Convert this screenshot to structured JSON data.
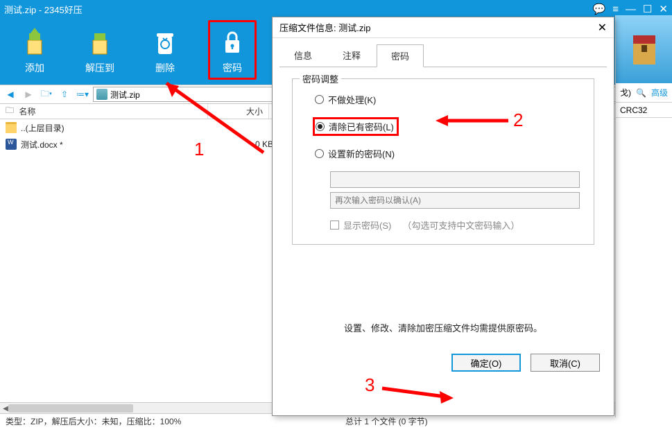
{
  "titlebar": {
    "text": "测试.zip - 2345好压"
  },
  "toolbar": {
    "add": "添加",
    "extract": "解压到",
    "delete": "删除",
    "password": "密码"
  },
  "nav": {
    "path": "测试.zip"
  },
  "columns": {
    "name": "名称",
    "size": "大小",
    "crc": "CRC32"
  },
  "rows": [
    {
      "icon": "folder",
      "name": "..(上层目录)",
      "size": ""
    },
    {
      "icon": "docx",
      "name": "测试.docx *",
      "size": "0 KB"
    }
  ],
  "rstripe": {
    "close_hint": "戈)",
    "adv": "高级"
  },
  "status": {
    "left": "类型：ZIP，解压后大小：未知，压缩比：100%",
    "right": "总计 1 个文件 (0 字节)"
  },
  "dialog": {
    "title": "压缩文件信息: 测试.zip",
    "tabs": {
      "info": "信息",
      "comment": "注释",
      "password": "密码"
    },
    "group_title": "密码调整",
    "r_none": "不做处理(K)",
    "r_clear": "清除已有密码(L)",
    "r_set": "设置新的密码(N)",
    "ph_confirm": "再次输入密码以确认(A)",
    "show_pwd": "显示密码(S)",
    "show_hint": "（勾选可支持中文密码输入）",
    "note": "设置、修改、清除加密压缩文件均需提供原密码。",
    "ok": "确定(O)",
    "cancel": "取消(C)"
  },
  "anno": {
    "n1": "1",
    "n2": "2",
    "n3": "3"
  }
}
